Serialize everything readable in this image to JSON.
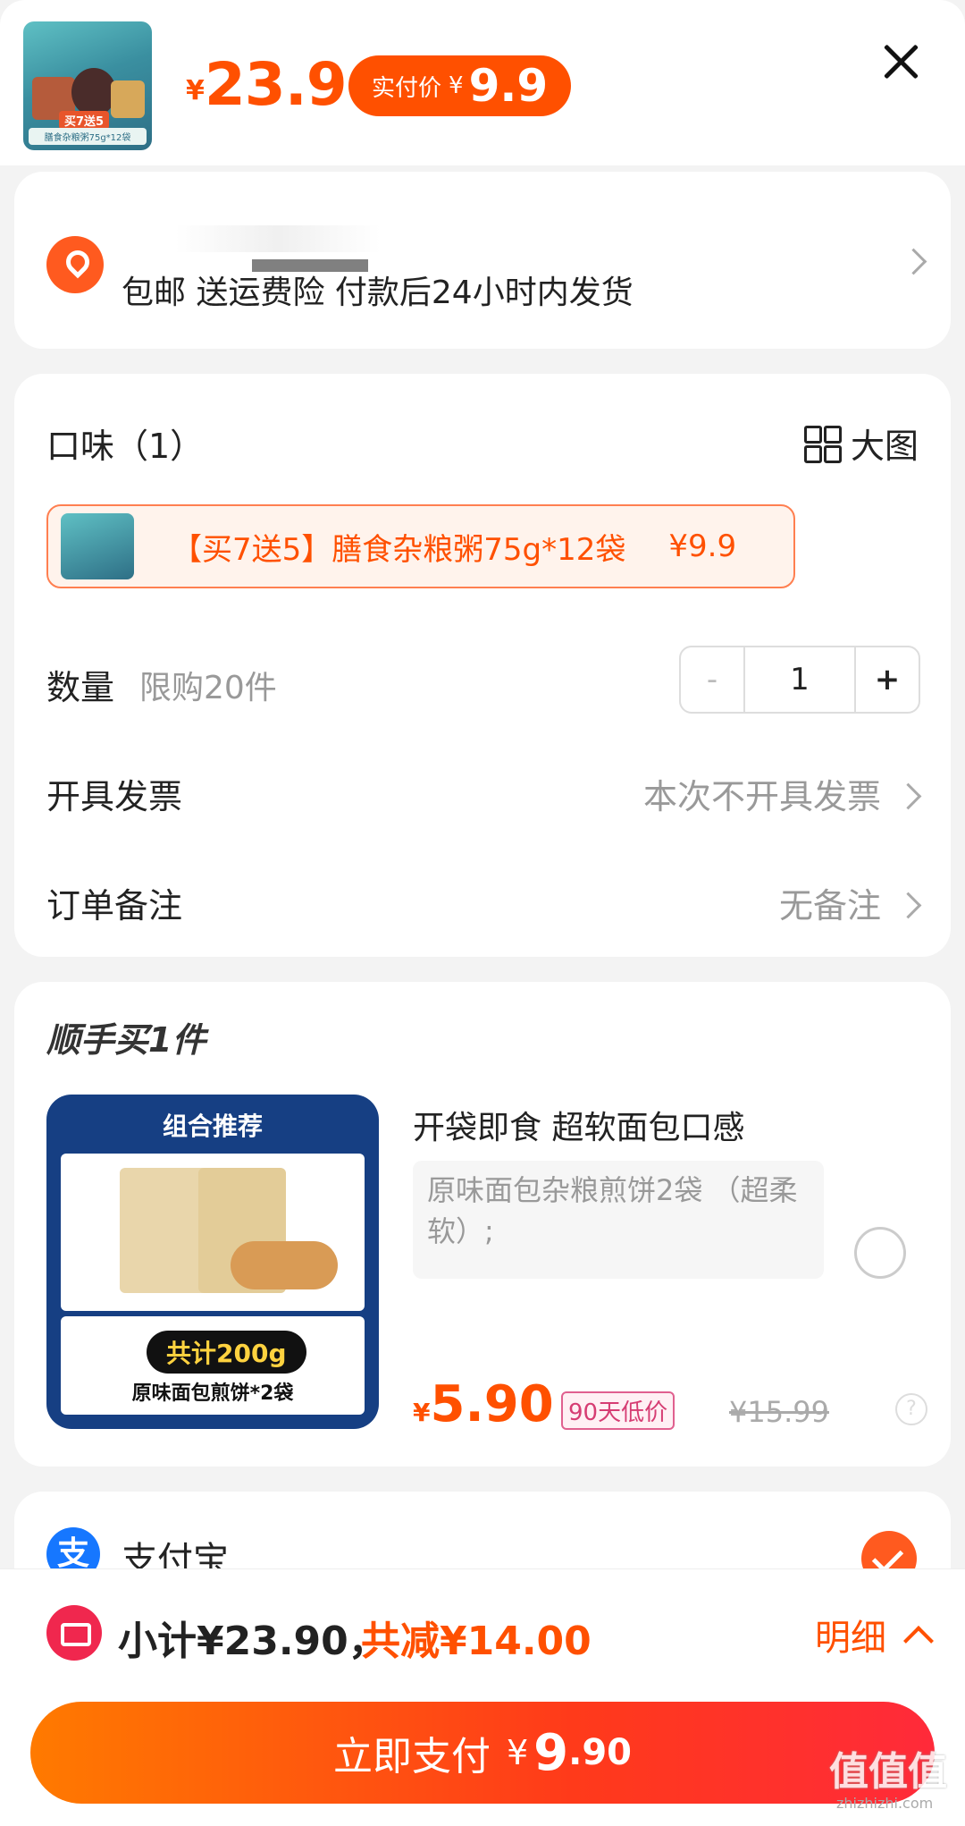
{
  "header": {
    "price_symbol": "¥",
    "price": "23.9",
    "paid_label": "实付价",
    "paid_symbol": "¥",
    "paid_price": "9.9",
    "thumb_badge": "买7送5",
    "thumb_caption": "膳食杂粮粥75g*12袋",
    "close_icon": "close-icon"
  },
  "address": {
    "icon": "location-pin-icon",
    "line": "包邮 送运费险 付款后24小时内发货"
  },
  "options": {
    "flavor_label": "口味（1）",
    "big_image_label": "大图",
    "variant_name": "【买7送5】膳食杂粮粥75g*12袋",
    "variant_price": "¥9.9",
    "qty_label": "数量",
    "qty_limit": "限购20件",
    "qty_minus": "-",
    "qty_value": "1",
    "qty_plus": "+",
    "invoice_label": "开具发票",
    "invoice_value": "本次不开具发票",
    "note_label": "订单备注",
    "note_value": "无备注"
  },
  "addon": {
    "title": "顺手买1件",
    "combo_title": "组合推荐",
    "combo_weight": "共计200g",
    "combo_name": "原味面包煎饼*2袋",
    "name": "开袋即食 超软面包口感",
    "desc": "原味面包杂粮煎饼2袋 （超柔软）;",
    "price_symbol": "¥",
    "price": "5.90",
    "low_tag": "90天低价",
    "orig_price": "¥15.99",
    "help": "?"
  },
  "payment": {
    "method": "支付宝",
    "icon_glyph": "支"
  },
  "bottom": {
    "subtotal": "小计¥23.90，",
    "saved": "共减¥14.00",
    "detail": "明细",
    "pay_label": "立即支付",
    "pay_symbol": "¥",
    "pay_int": "9",
    "pay_dec": ".90",
    "watermark": "值值值",
    "watermark_sub": "zhizhizhi.com"
  },
  "colors": {
    "accent": "#ff5000",
    "alipay": "#1677ff",
    "combo_bg": "#163f83"
  }
}
